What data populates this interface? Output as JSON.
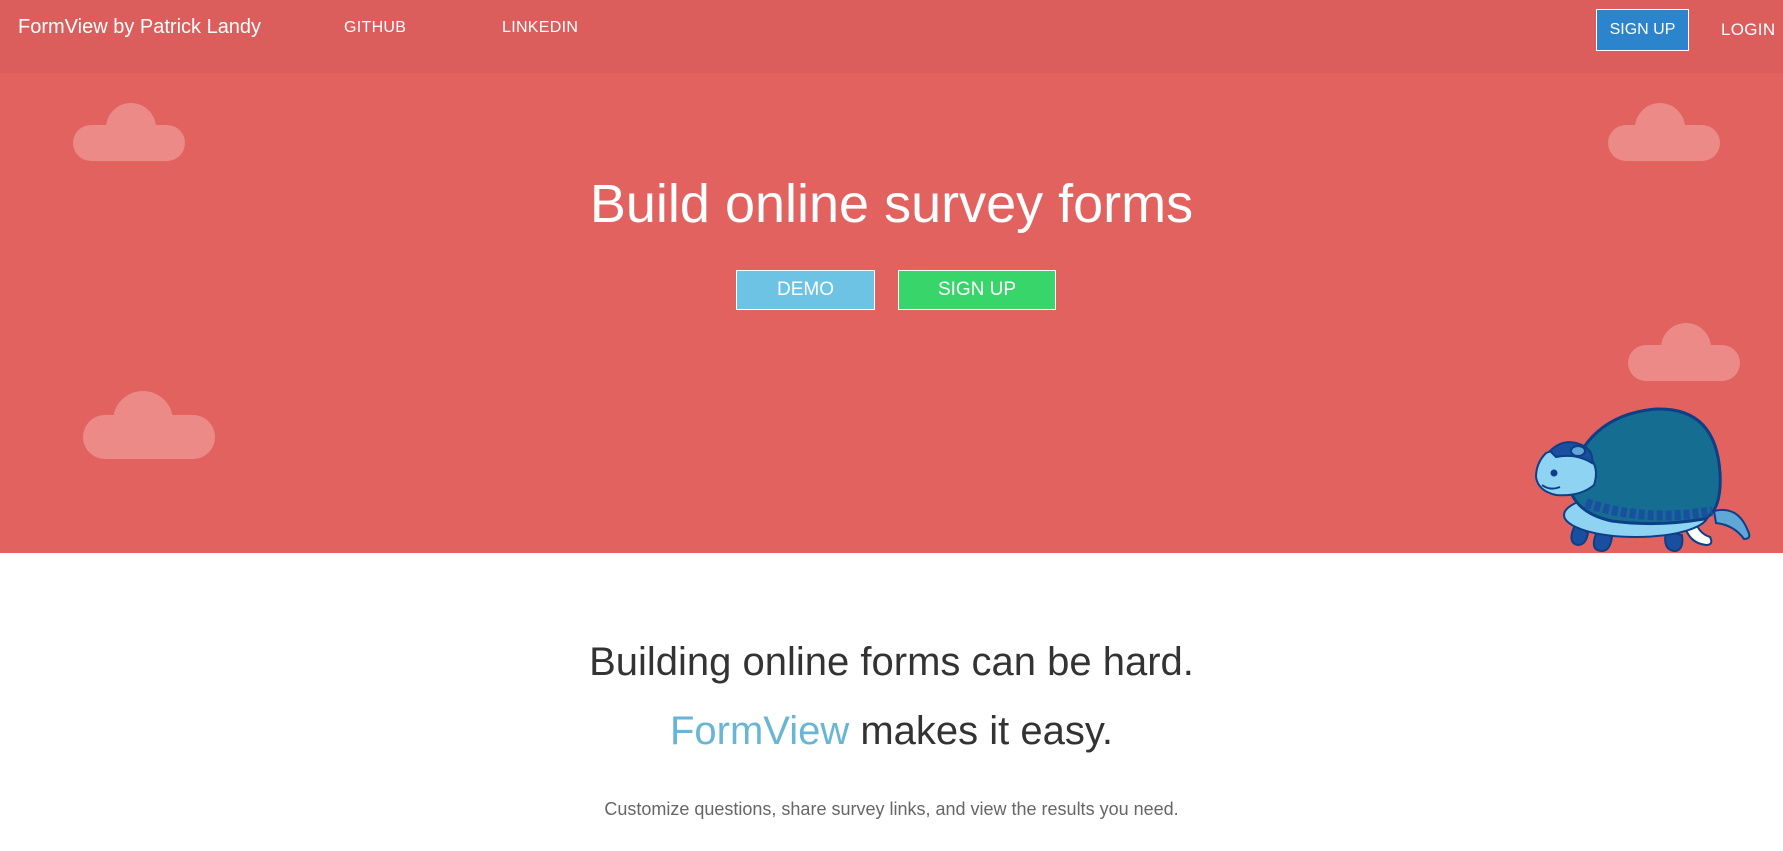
{
  "nav": {
    "brand": "FormView by Patrick Landy",
    "links": [
      {
        "label": "GITHUB"
      },
      {
        "label": "LINKEDIN"
      }
    ],
    "signup_label": "SIGN UP",
    "login_label": "LOGIN"
  },
  "hero": {
    "title": "Build online survey forms",
    "demo_label": "DEMO",
    "signup_label": "SIGN UP"
  },
  "intro": {
    "line1": "Building online forms can be hard.",
    "brand_word": "FormView",
    "line2_rest": " makes it easy.",
    "description": "Customize questions, share survey links, and view the results you need."
  },
  "colors": {
    "nav_bg": "#dc5e5c",
    "hero_bg": "#e26260",
    "demo_button": "#6cc3e3",
    "signup_button": "#38d56a",
    "nav_signup_button": "#2c84cc",
    "brand_accent": "#69b5d4",
    "cloud": "#eb8a87",
    "mascot_shell": "#156e92"
  },
  "icons": {
    "cloud": "cloud-icon",
    "mascot": "armadillo-mascot"
  }
}
